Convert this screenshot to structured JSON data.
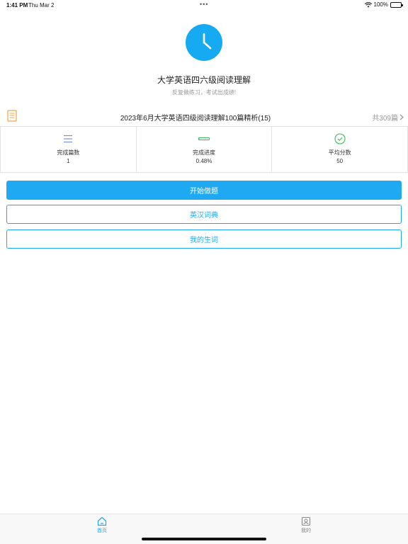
{
  "status_bar": {
    "time": "1:41 PM",
    "date": "Thu Mar 2",
    "battery": "100%"
  },
  "header": {
    "title": "大学英语四六级阅读理解",
    "subtitle": "反复做练习，考试出成绩!",
    "icon": "clock-icon",
    "accent_color": "#16aaf2"
  },
  "book": {
    "title": "2023年6月大学英语四级阅读理解100篇精析(15)",
    "count": "共309篇",
    "icon": "document-icon"
  },
  "stats": [
    {
      "label": "完成篇数",
      "value": "1",
      "icon": "list-icon"
    },
    {
      "label": "完成进度",
      "value": "0.48%",
      "icon": "progress-bar-icon",
      "progress": 0.0048
    },
    {
      "label": "平均分数",
      "value": "50",
      "icon": "check-circle-icon"
    }
  ],
  "actions": {
    "start": "开始做题",
    "dictionary": "英汉词典",
    "my_words": "我的生词"
  },
  "tabs": [
    {
      "label": "首页",
      "icon": "home-icon",
      "active": true
    },
    {
      "label": "我的",
      "icon": "profile-icon",
      "active": false
    }
  ]
}
